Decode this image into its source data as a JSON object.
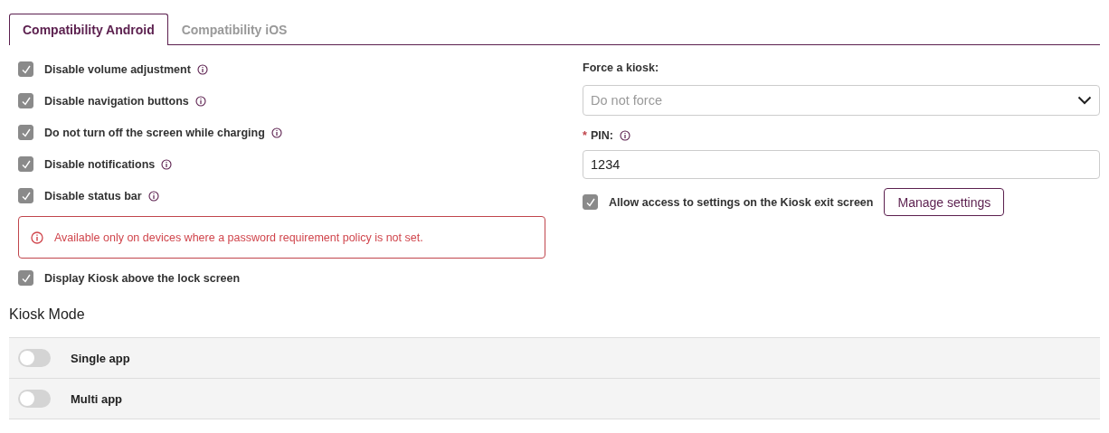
{
  "tabs": [
    {
      "label": "Compatibility Android",
      "selected": true
    },
    {
      "label": "Compatibility iOS",
      "selected": false
    }
  ],
  "options": [
    {
      "label": "Disable volume adjustment",
      "checked": true,
      "info": true
    },
    {
      "label": "Disable navigation buttons",
      "checked": true,
      "info": true
    },
    {
      "label": "Do not turn off the screen while charging",
      "checked": true,
      "info": true
    },
    {
      "label": "Disable notifications",
      "checked": true,
      "info": true
    },
    {
      "label": "Disable status bar",
      "checked": true,
      "info": true
    }
  ],
  "warning": "Available only on devices where a password requirement policy is not set.",
  "lock_screen_option": {
    "label": "Display Kiosk above the lock screen",
    "checked": true,
    "info": false
  },
  "force_kiosk": {
    "label": "Force a kiosk:",
    "placeholder": "Do not force"
  },
  "pin": {
    "required_mark": "*",
    "label": "PIN:",
    "value": "1234"
  },
  "exit_settings": {
    "label": "Allow access to settings on the Kiosk exit screen",
    "checked": true,
    "button": "Manage settings"
  },
  "kiosk_mode": {
    "title": "Kiosk Mode",
    "rows": [
      {
        "label": "Single app",
        "on": false
      },
      {
        "label": "Multi app",
        "on": false
      }
    ]
  }
}
